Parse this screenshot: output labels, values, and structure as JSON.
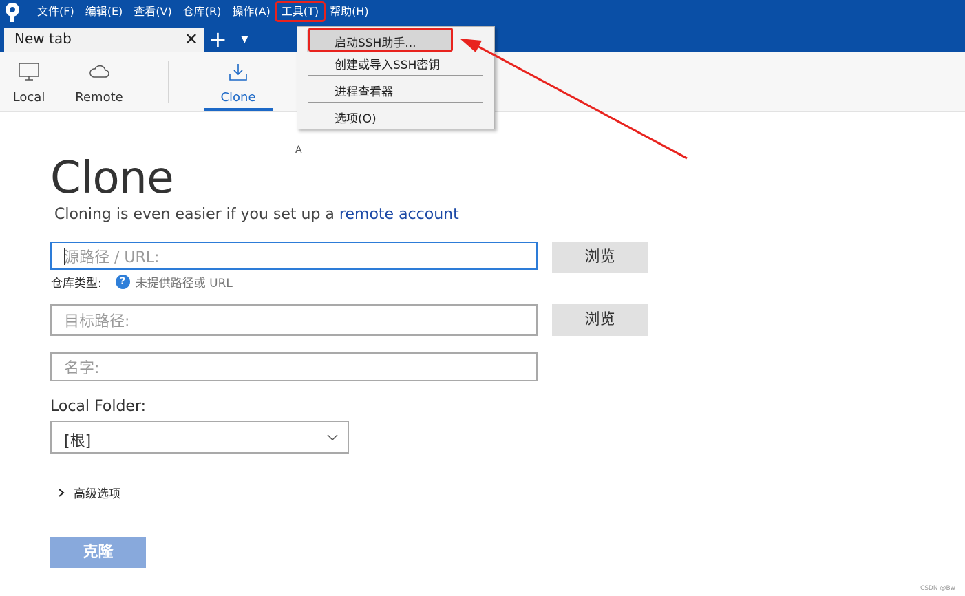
{
  "menubar": {
    "items": [
      "文件(F)",
      "编辑(E)",
      "查看(V)",
      "仓库(R)",
      "操作(A)",
      "工具(T)",
      "帮助(H)"
    ]
  },
  "tabs": {
    "active_label": "New tab",
    "close_glyph": "✕",
    "add_glyph": "+",
    "dropdown_glyph": "▼"
  },
  "toolbar": {
    "local": "Local",
    "remote": "Remote",
    "clone": "Clone",
    "partial": "A"
  },
  "tools_menu": {
    "items": [
      "启动SSH助手...",
      "创建或导入SSH密钥",
      "进程查看器",
      "选项(O)"
    ]
  },
  "clone": {
    "heading": "Clone",
    "subtext_prefix": "Cloning is even easier if you set up a ",
    "subtext_link": "remote account",
    "source_placeholder": "源路径 / URL:",
    "browse_label": "浏览",
    "repo_type_label": "仓库类型:",
    "repo_type_status": "未提供路径或 URL",
    "help_glyph": "?",
    "dest_placeholder": "目标路径:",
    "name_placeholder": "名字:",
    "local_folder_label": "Local Folder:",
    "local_folder_value": "[根]",
    "advanced_label": "高级选项",
    "clone_button": "克隆"
  },
  "colors": {
    "titlebar": "#0a4fa6",
    "accent": "#1d69c7",
    "highlight": "#e8231e",
    "clone_button": "#88a9dc"
  },
  "watermark": "CSDN @Bw"
}
